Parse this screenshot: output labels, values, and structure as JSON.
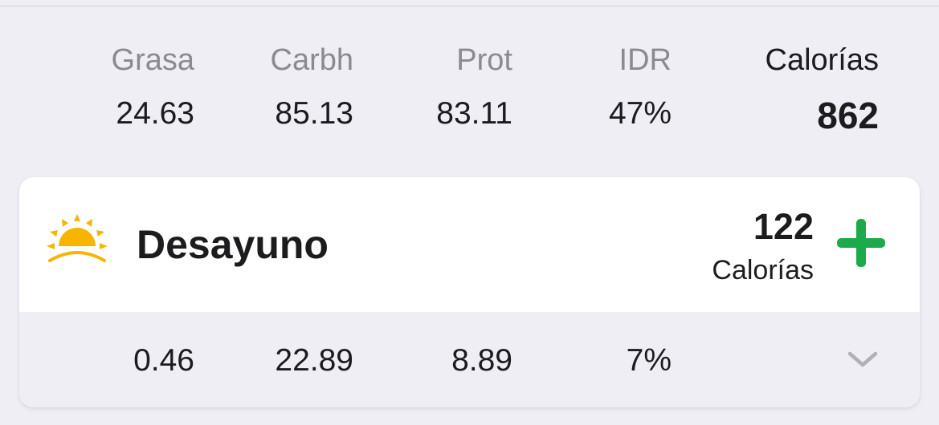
{
  "summary": {
    "labels": {
      "grasa": "Grasa",
      "carbh": "Carbh",
      "prot": "Prot",
      "idr": "IDR",
      "calorias": "Calorías"
    },
    "values": {
      "grasa": "24.63",
      "carbh": "85.13",
      "prot": "83.11",
      "idr": "47%",
      "calorias": "862"
    }
  },
  "meal": {
    "icon": "sunrise-icon",
    "title": "Desayuno",
    "calories_value": "122",
    "calories_label": "Calorías",
    "add_icon": "plus-icon",
    "expand_icon": "chevron-down-icon",
    "macros": {
      "grasa": "0.46",
      "carbh": "22.89",
      "prot": "8.89",
      "idr": "7%"
    }
  },
  "colors": {
    "background": "#EEEEF4",
    "card": "#FFFFFF",
    "accent_green": "#1DAA4B",
    "sun_yellow": "#F7B500"
  }
}
